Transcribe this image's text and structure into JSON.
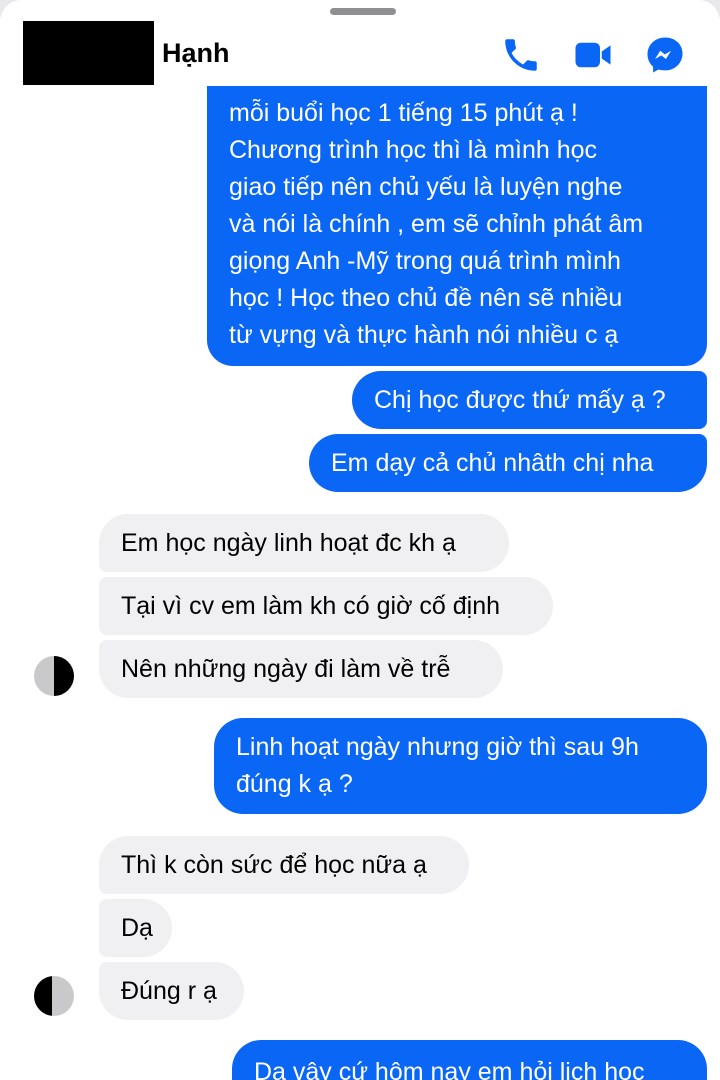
{
  "header": {
    "contact_name": "Hạnh",
    "icons": [
      "phone-icon",
      "video-camera-icon",
      "messenger-icon"
    ],
    "accent_color": "#0a66f5"
  },
  "messages": [
    {
      "from": "me",
      "text": "mỗi buổi học 1 tiếng 15 phút ạ !\nChương trình học thì là  mình học\ngiao tiếp nên chủ yếu là luyện nghe\nvà nói là chính , em sẽ chỉnh phát âm\ngiọng Anh -Mỹ trong quá trình mình\nhọc ! Học theo chủ đề nên sẽ nhiều\ntừ vựng và thực hành nói nhiều c ạ"
    },
    {
      "from": "me",
      "text": "Chị học được thứ mấy ạ ?"
    },
    {
      "from": "me",
      "text": "Em dạy cả chủ nhâth chị nha"
    },
    {
      "from": "them",
      "text": "Em học ngày linh hoạt đc kh ạ"
    },
    {
      "from": "them",
      "text": "Tại vì cv em làm kh có giờ cố định"
    },
    {
      "from": "them",
      "text": "Nên những ngày đi làm về trễ"
    },
    {
      "from": "me",
      "text": "Linh hoạt ngày nhưng giờ thì sau 9h\nđúng k ạ ?"
    },
    {
      "from": "them",
      "text": "Thì k còn sức để học nữa ạ"
    },
    {
      "from": "them",
      "text": "Dạ"
    },
    {
      "from": "them",
      "text": "Đúng r ạ"
    },
    {
      "from": "me",
      "text": "Dạ vậy cứ hôm nay em hỏi lịch học"
    }
  ]
}
